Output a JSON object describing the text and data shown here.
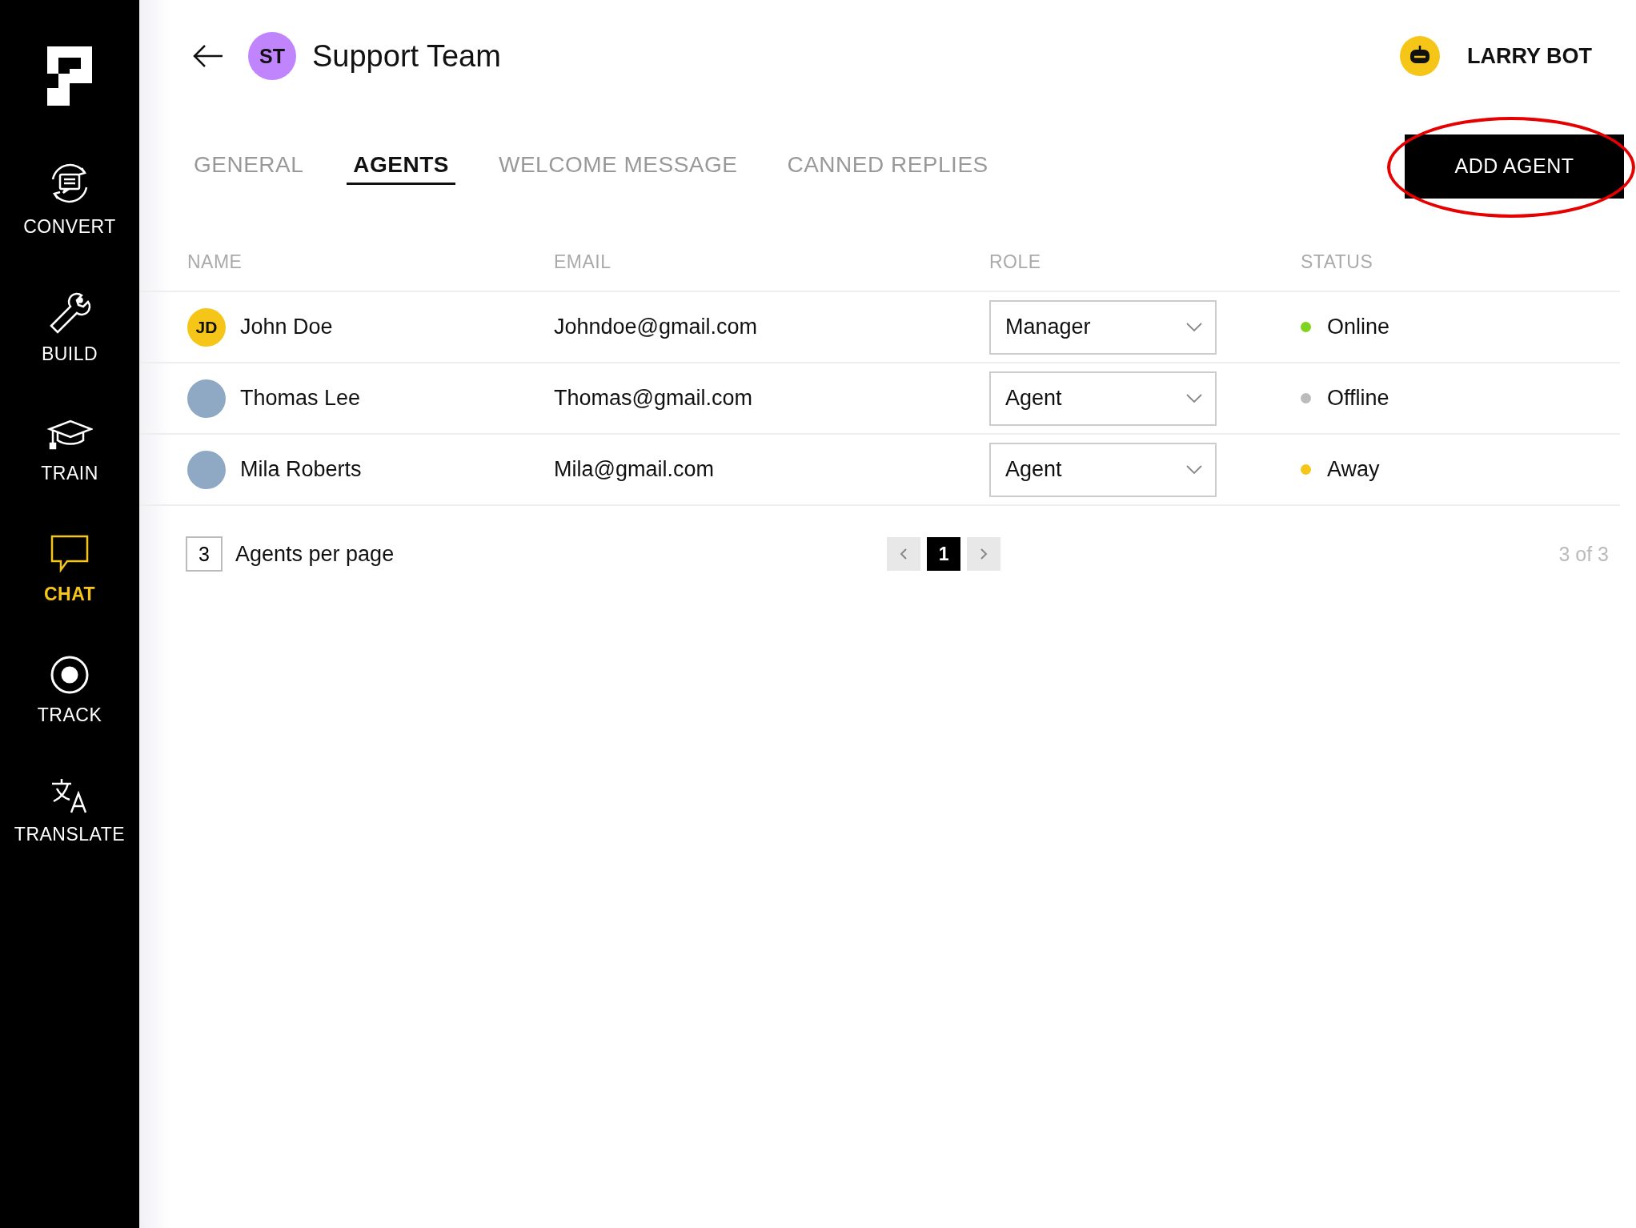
{
  "sidebar": {
    "items": [
      {
        "label": "CONVERT",
        "selected": false
      },
      {
        "label": "BUILD",
        "selected": false
      },
      {
        "label": "TRAIN",
        "selected": false
      },
      {
        "label": "CHAT",
        "selected": true
      },
      {
        "label": "TRACK",
        "selected": false
      },
      {
        "label": "TRANSLATE",
        "selected": false
      }
    ]
  },
  "header": {
    "team_initials": "ST",
    "title": "Support Team",
    "bot_name": "LARRY BOT"
  },
  "tabs": [
    {
      "label": "GENERAL",
      "selected": false
    },
    {
      "label": "AGENTS",
      "selected": true
    },
    {
      "label": "WELCOME MESSAGE",
      "selected": false
    },
    {
      "label": "CANNED REPLIES",
      "selected": false
    }
  ],
  "add_button": {
    "label": "ADD AGENT",
    "highlighted": true
  },
  "table": {
    "columns": [
      "NAME",
      "EMAIL",
      "ROLE",
      "STATUS"
    ],
    "rows": [
      {
        "avatar": {
          "kind": "initials",
          "initials": "JD"
        },
        "name": "John Doe",
        "email": "Johndoe@gmail.com",
        "role": "Manager",
        "status": "Online",
        "color": "#7ed321"
      },
      {
        "avatar": {
          "kind": "photo"
        },
        "name": "Thomas Lee",
        "email": "Thomas@gmail.com",
        "role": "Agent",
        "status": "Offline",
        "color": "#bbbbbb"
      },
      {
        "avatar": {
          "kind": "photo"
        },
        "name": "Mila Roberts",
        "email": "Mila@gmail.com",
        "role": "Agent",
        "status": "Away",
        "color": "#f5c518"
      }
    ]
  },
  "pagination": {
    "per_page": "3",
    "per_page_label": "Agents per page",
    "pages": [
      {
        "label": "1",
        "selected": true
      }
    ],
    "summary": "3 of 3"
  }
}
